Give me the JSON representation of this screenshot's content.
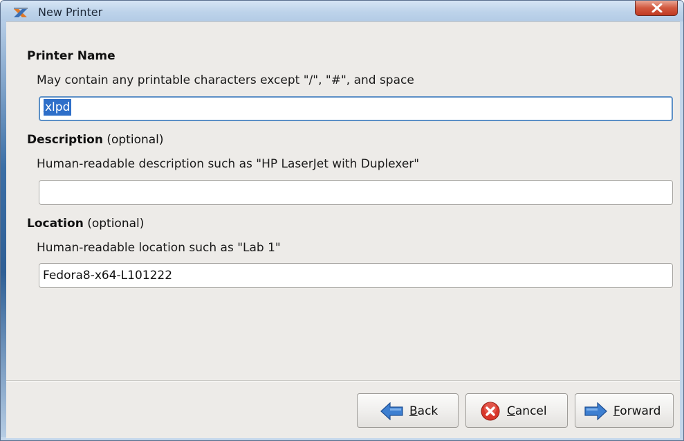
{
  "window": {
    "title": "New Printer"
  },
  "form": {
    "printer_name": {
      "heading": "Printer Name",
      "hint": "May contain any printable characters except \"/\", \"#\", and space",
      "value": "xlpd"
    },
    "description": {
      "heading": "Description",
      "heading_suffix": " (optional)",
      "hint": "Human-readable description such as \"HP LaserJet with Duplexer\"",
      "value": ""
    },
    "location": {
      "heading": "Location",
      "heading_suffix": " (optional)",
      "hint": "Human-readable location such as \"Lab 1\"",
      "value": "Fedora8-x64-L101222"
    }
  },
  "buttons": {
    "back": {
      "mnemonic": "B",
      "rest": "ack",
      "icon": "back-arrow-icon"
    },
    "cancel": {
      "mnemonic": "C",
      "rest": "ancel",
      "icon": "cancel-icon"
    },
    "forward": {
      "mnemonic": "F",
      "rest": "orward",
      "icon": "forward-arrow-icon"
    }
  },
  "colors": {
    "accent_arrow": "#3d7fd1",
    "cancel_red": "#d8362a",
    "selection": "#2e6fc9"
  }
}
